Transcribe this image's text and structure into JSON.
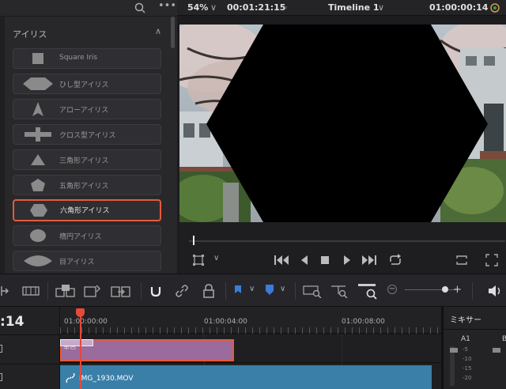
{
  "header": {
    "zoom": "54%",
    "zoom_chevron": "∨",
    "source_timecode": "00:01:21:15",
    "timeline_name": "Timeline 1",
    "timeline_chevron": "∨",
    "record_timecode": "01:00:00:14"
  },
  "effects_panel": {
    "section_title": "アイリス",
    "items": [
      {
        "label": "Square Iris",
        "icon": "square-iris-icon"
      },
      {
        "label": "ひし型アイリス",
        "icon": "diamond-iris-icon"
      },
      {
        "label": "アローアイリス",
        "icon": "arrow-iris-icon"
      },
      {
        "label": "クロス型アイリス",
        "icon": "cross-iris-icon"
      },
      {
        "label": "三角形アイリス",
        "icon": "triangle-iris-icon"
      },
      {
        "label": "五角形アイリス",
        "icon": "pentagon-iris-icon"
      },
      {
        "label": "六角形アイリス",
        "icon": "hexagon-iris-icon"
      },
      {
        "label": "楕円アイリス",
        "icon": "ellipse-iris-icon"
      },
      {
        "label": "目アイリス",
        "icon": "eye-iris-icon"
      }
    ],
    "selected_index": 6
  },
  "timeline": {
    "current_timecode_partial": ":14",
    "ruler_labels": [
      "01:00:00:00",
      "01:00:04:00",
      "01:00:08:00"
    ],
    "title_clip_label": "単色",
    "video_clip_label": "IMG_1930.MOV",
    "colors": {
      "title_clip": "#9b6b9e",
      "video_clip": "#3a7fa8",
      "playhead": "#e5493a",
      "selection": "#e65a3a"
    }
  },
  "mixer": {
    "title": "ミキサー",
    "channel": "A1",
    "channel_b": "B",
    "meter_labels": [
      "-5",
      "-10",
      "-15",
      "-20"
    ]
  }
}
